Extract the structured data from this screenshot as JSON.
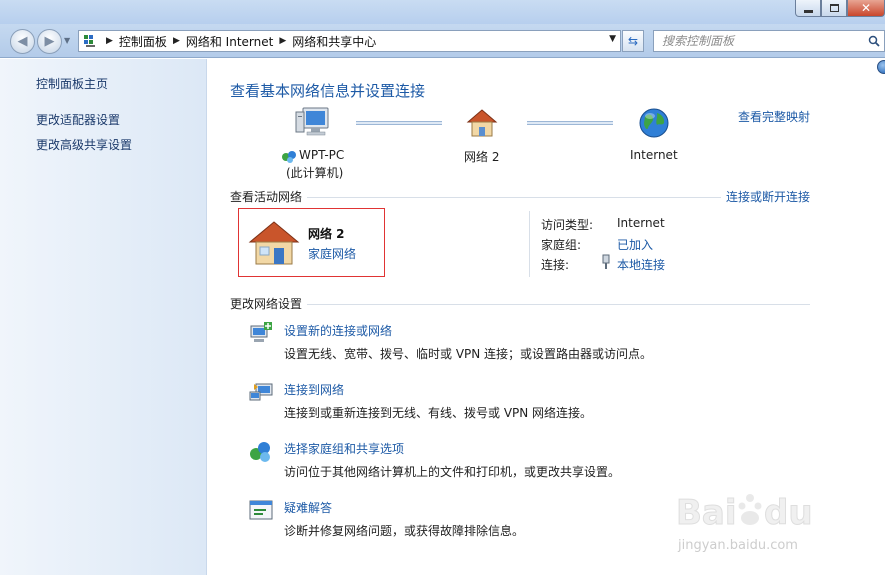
{
  "address_bar": {
    "crumbs": [
      "控制面板",
      "网络和 Internet",
      "网络和共享中心"
    ]
  },
  "search": {
    "placeholder": "搜索控制面板"
  },
  "sidebar": {
    "items": [
      {
        "label": "控制面板主页"
      },
      {
        "label": "更改适配器设置"
      },
      {
        "label": "更改高级共享设置"
      }
    ]
  },
  "main": {
    "title": "查看基本网络信息并设置连接",
    "view_full_map": "查看完整映射",
    "map": {
      "pc_name": "WPT-PC",
      "pc_sub": "(此计算机)",
      "network": "网络  2",
      "internet": "Internet"
    },
    "active_networks": {
      "heading": "查看活动网络",
      "connect_link": "连接或断开连接",
      "network_name": "网络  2",
      "network_type": "家庭网络",
      "access_type_label": "访问类型:",
      "access_type_value": "Internet",
      "homegroup_label": "家庭组:",
      "homegroup_value": "已加入",
      "connection_label": "连接:",
      "connection_value": "本地连接"
    },
    "change_settings": {
      "heading": "更改网络设置",
      "tasks": [
        {
          "link": "设置新的连接或网络",
          "desc": "设置无线、宽带、拨号、临时或 VPN 连接；或设置路由器或访问点。",
          "icon": "new-connection-icon"
        },
        {
          "link": "连接到网络",
          "desc": "连接到或重新连接到无线、有线、拨号或 VPN 网络连接。",
          "icon": "connect-network-icon"
        },
        {
          "link": "选择家庭组和共享选项",
          "desc": "访问位于其他网络计算机上的文件和打印机，或更改共享设置。",
          "icon": "homegroup-icon"
        },
        {
          "link": "疑难解答",
          "desc": "诊断并修复网络问题，或获得故障排除信息。",
          "icon": "troubleshoot-icon"
        }
      ]
    }
  },
  "watermark": {
    "text": "jingyan.baidu.com"
  },
  "colors": {
    "link": "#1d5aa6",
    "highlight_border": "#e03434"
  }
}
